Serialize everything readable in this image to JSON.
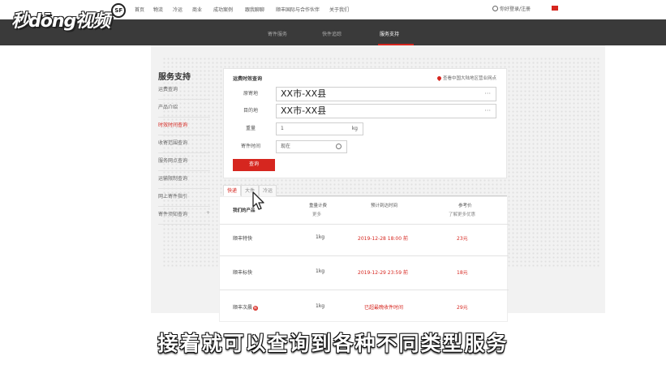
{
  "watermark": {
    "text": "秒dōng视频",
    "badge": "SF"
  },
  "topnav": {
    "items": [
      "首页",
      "物流",
      "冷运",
      "商业",
      "成功案例",
      "跟我聊聊",
      "顺丰国际与合作伙伴",
      "关于我们"
    ],
    "login": "你好登录/注册"
  },
  "subnav": {
    "tabs": [
      "寄件服务",
      "快件追踪",
      "服务支持"
    ]
  },
  "sidebar": {
    "title": "服务支持",
    "items": [
      "运费查询",
      "产品介绍",
      "时效时间查询",
      "收寄范围查询",
      "服务网点查询",
      "运输限制查询",
      "网上寄件指引",
      "寄件须知查询"
    ]
  },
  "query": {
    "title": "运费时效查询",
    "network_link": "查看中国大陆地区营业网点",
    "origin_label": "原寄地",
    "origin_value": "XX市-XX县",
    "dest_label": "目的地",
    "dest_value": "XX市-XX县",
    "weight_label": "重量",
    "weight_value": "1",
    "weight_unit": "kg",
    "time_label": "寄件时间",
    "time_placeholder": "现在",
    "submit": "查询"
  },
  "result_tabs": [
    "快递",
    "大件",
    "冷运"
  ],
  "table": {
    "headers": {
      "product": "我们的产品",
      "weight": "重量计费",
      "weight_sub": "更多",
      "time": "预计到达时间",
      "price": "参考价",
      "price_sub": "了解更多优惠"
    },
    "rows": [
      {
        "product": "顺丰特快",
        "weight": "1kg",
        "time": "2019-12-28 18:00 前",
        "price": "23元",
        "badge": ""
      },
      {
        "product": "顺丰标快",
        "weight": "1kg",
        "time": "2019-12-29 23:59 前",
        "price": "18元",
        "badge": ""
      },
      {
        "product": "顺丰次晨",
        "weight": "1kg",
        "time": "已超最晚收件时间",
        "price": "29元",
        "badge": "新"
      }
    ]
  },
  "subtitle": "接着就可以查询到各种不同类型服务",
  "colors": {
    "accent": "#d6261f",
    "band": "#3a3a3a"
  }
}
